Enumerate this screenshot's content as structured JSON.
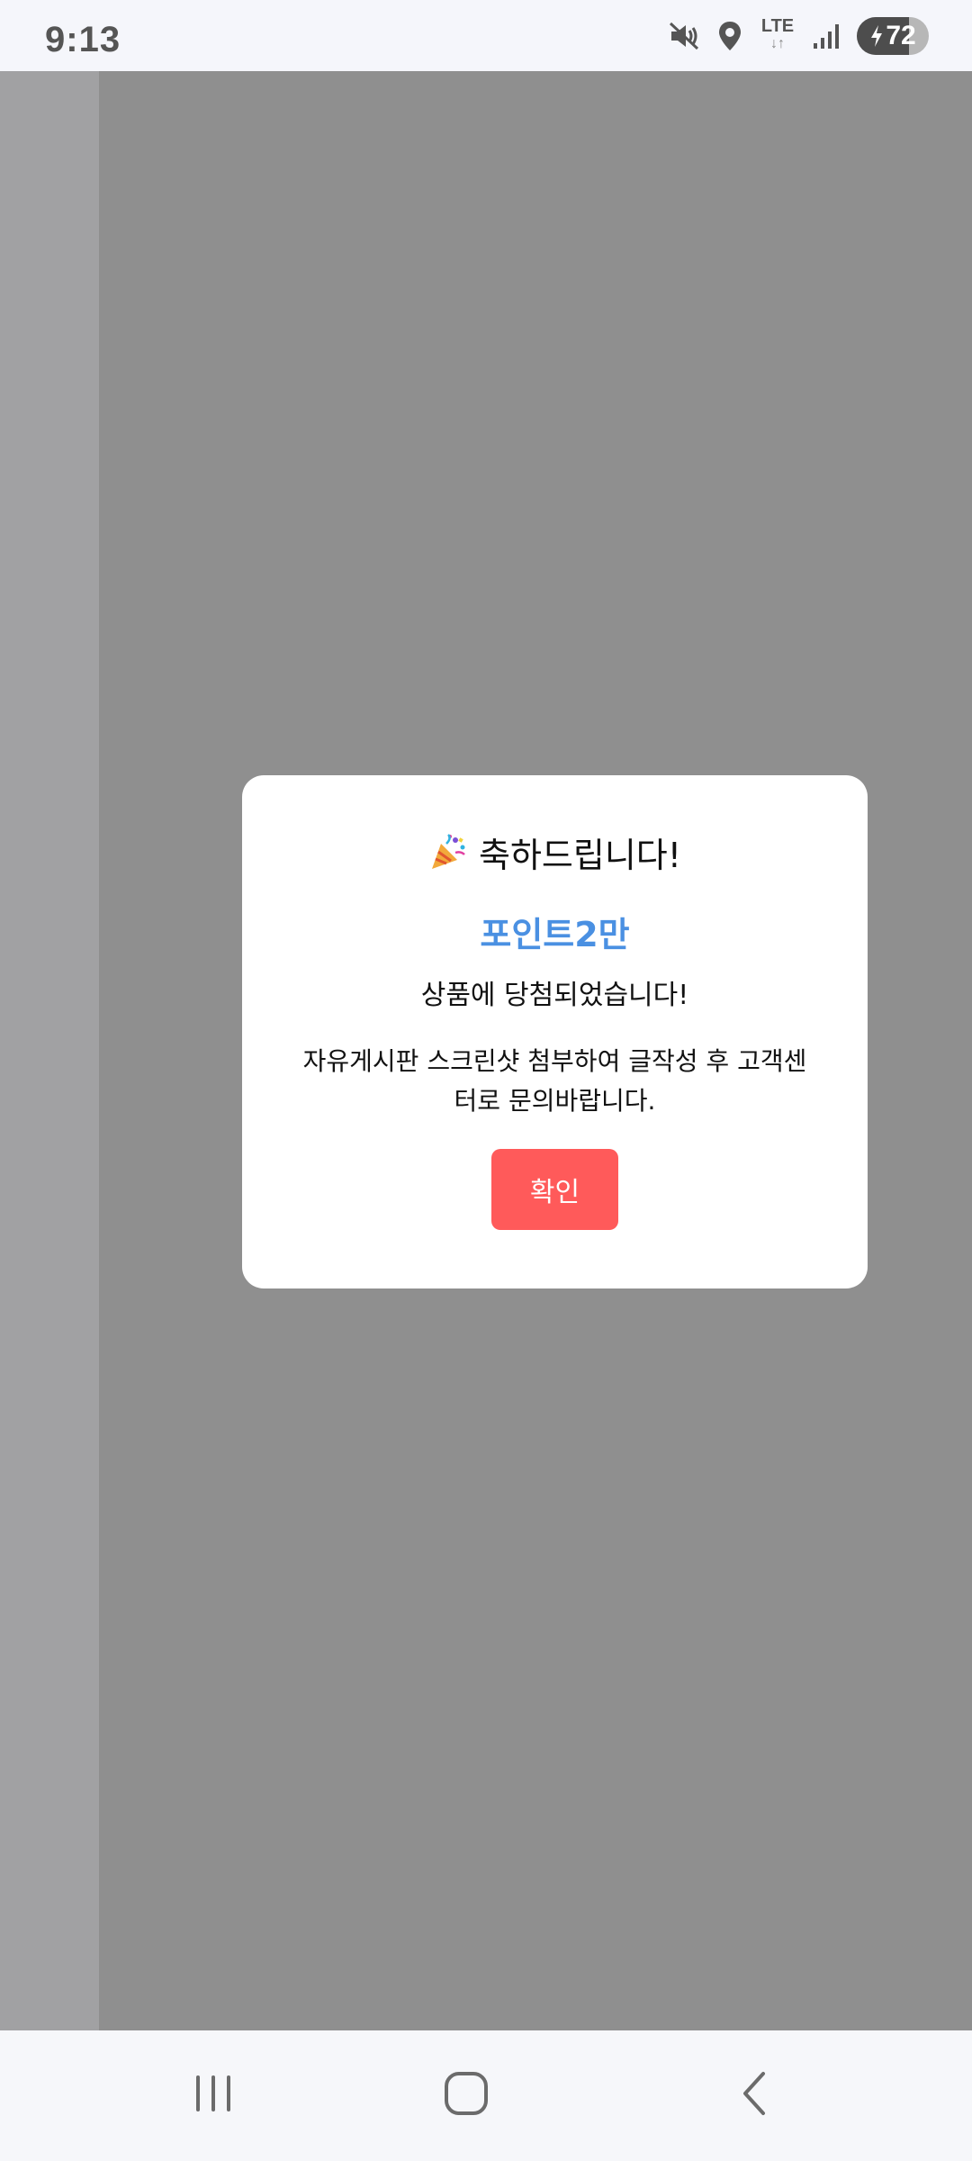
{
  "status_bar": {
    "time": "9:13",
    "network_label": "LTE",
    "network_arrows": "↓↑",
    "battery_level": "72",
    "icons": [
      "mute-icon",
      "location-icon",
      "lte-icon",
      "signal-icon",
      "battery-charging-icon"
    ]
  },
  "dialog": {
    "emoji_icon": "party-popper-icon",
    "title": "축하드립니다!",
    "prize_name": "포인트2만",
    "prize_message": "상품에 당첨되었습니다!",
    "instruction": "자유게시판 스크린샷 첨부하여 글작성 후 고객센터로 문의바랍니다.",
    "confirm_label": "확인",
    "accent_color": "#4a90e2",
    "button_color": "#ff5a5a"
  },
  "navigation_bar": {
    "icons": [
      "recents-icon",
      "home-icon",
      "back-icon"
    ]
  }
}
